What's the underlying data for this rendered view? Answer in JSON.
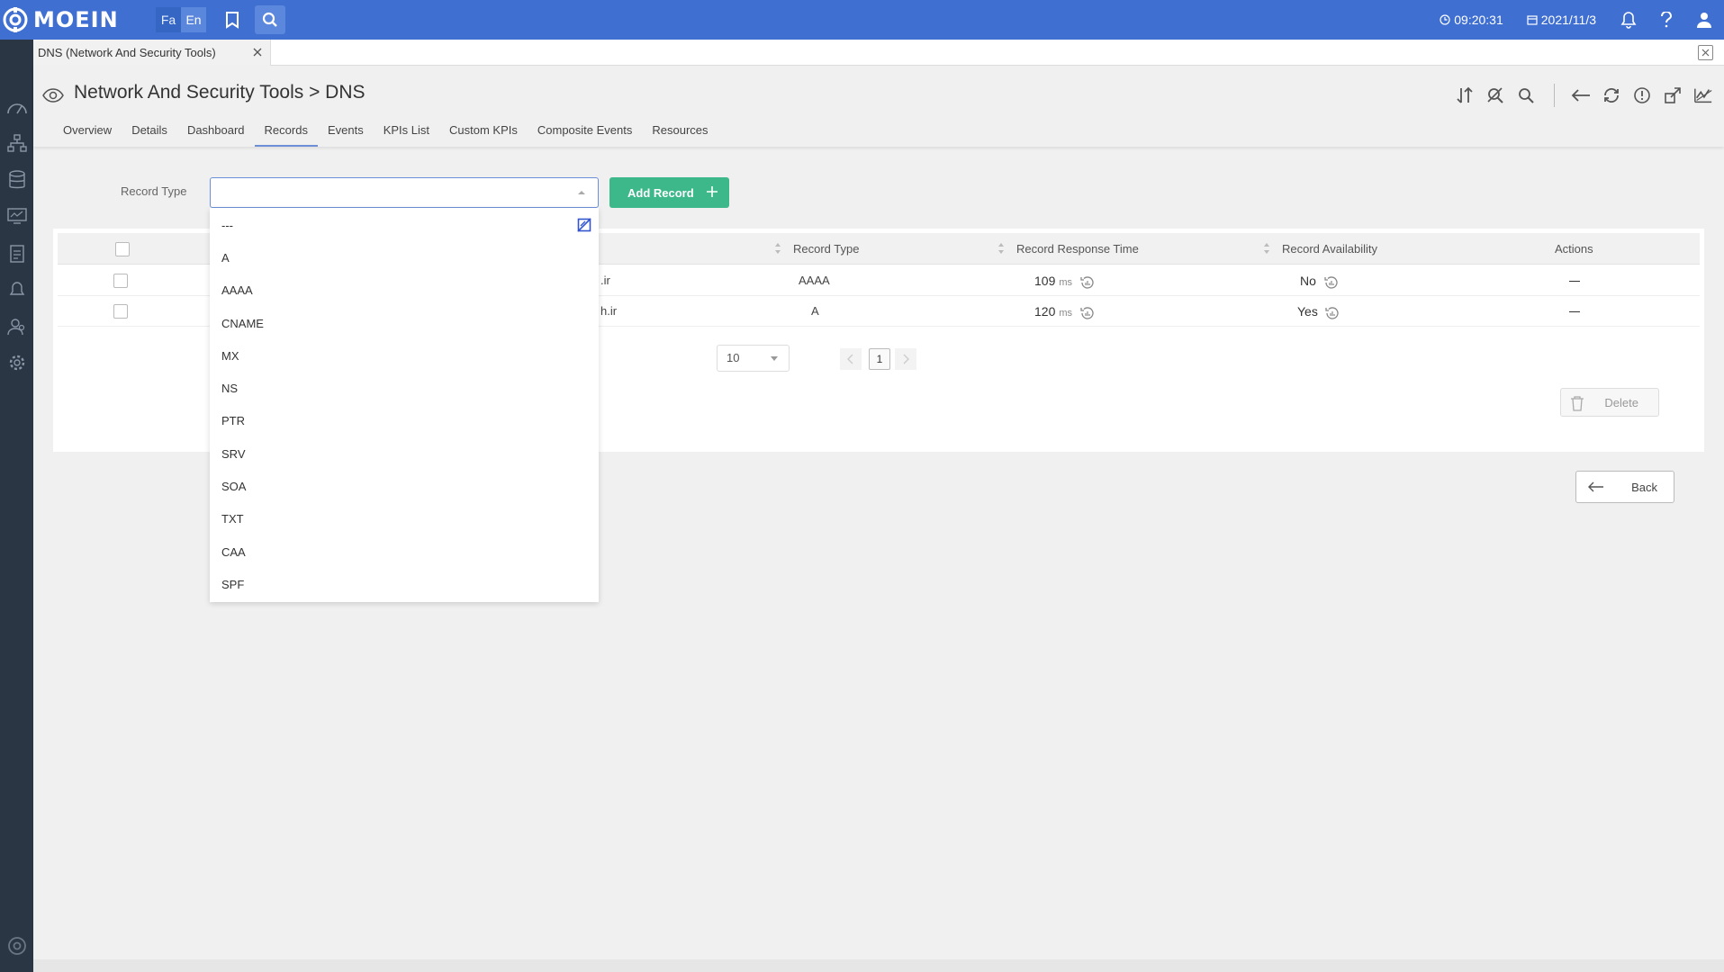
{
  "app": {
    "logo_text": "MOEIN",
    "lang_fa": "Fa",
    "lang_en": "En",
    "time": "09:20:31",
    "date": "2021/11/3"
  },
  "tab": {
    "title": "DNS (Network And Security Tools)"
  },
  "page": {
    "title": "Network And Security Tools > DNS",
    "subtabs": [
      "Overview",
      "Details",
      "Dashboard",
      "Records",
      "Events",
      "KPIs List",
      "Custom KPIs",
      "Composite Events",
      "Resources"
    ],
    "active_subtab": "Records"
  },
  "filter": {
    "label": "Record Type",
    "value": "",
    "add_button": "Add Record",
    "options": [
      "---",
      "A",
      "AAAA",
      "CNAME",
      "MX",
      "NS",
      "PTR",
      "SRV",
      "SOA",
      "TXT",
      "CAA",
      "SPF"
    ]
  },
  "table": {
    "columns": {
      "record_type": "Record Type",
      "response_time": "Record Response Time",
      "availability": "Record Availability",
      "actions": "Actions"
    },
    "rows": [
      {
        "name": ".ir",
        "type": "AAAA",
        "response": "109",
        "unit": "ms",
        "available": "No"
      },
      {
        "name": "h.ir",
        "type": "A",
        "response": "120",
        "unit": "ms",
        "available": "Yes"
      }
    ],
    "page_size": "10",
    "current_page": "1",
    "delete_label": "Delete"
  },
  "back_label": "Back",
  "colors": {
    "topbar": "#3f6fd1",
    "rail": "#2a3644",
    "add_button": "#3db88a",
    "active_tab_underline": "#6d8fd8"
  }
}
